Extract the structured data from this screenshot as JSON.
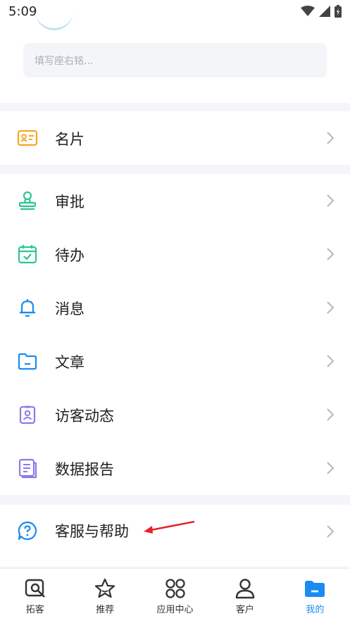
{
  "status_bar": {
    "time": "5:09"
  },
  "profile": {
    "motto_placeholder": "填写座右铭..."
  },
  "menu_groups": [
    {
      "items": [
        {
          "label": "名片",
          "icon": "business-card-icon"
        }
      ]
    },
    {
      "items": [
        {
          "label": "审批",
          "icon": "stamp-icon"
        },
        {
          "label": "待办",
          "icon": "calendar-check-icon"
        },
        {
          "label": "消息",
          "icon": "bell-icon"
        },
        {
          "label": "文章",
          "icon": "folder-icon"
        },
        {
          "label": "访客动态",
          "icon": "visitor-badge-icon"
        },
        {
          "label": "数据报告",
          "icon": "report-icon"
        }
      ]
    },
    {
      "items": [
        {
          "label": "客服与帮助",
          "icon": "help-chat-icon"
        }
      ]
    }
  ],
  "tabbar": {
    "tabs": [
      {
        "label": "拓客",
        "icon": "search-icon"
      },
      {
        "label": "推荐",
        "icon": "star-icon"
      },
      {
        "label": "应用中心",
        "icon": "apps-icon"
      },
      {
        "label": "客户",
        "icon": "user-icon"
      },
      {
        "label": "我的",
        "icon": "folder-icon",
        "active": true
      }
    ]
  },
  "colors": {
    "accent": "#1a8cf0",
    "card_orange": "#f5a623",
    "green": "#2ec58e",
    "purple": "#8a7be8",
    "annotation_red": "#e8232a"
  }
}
